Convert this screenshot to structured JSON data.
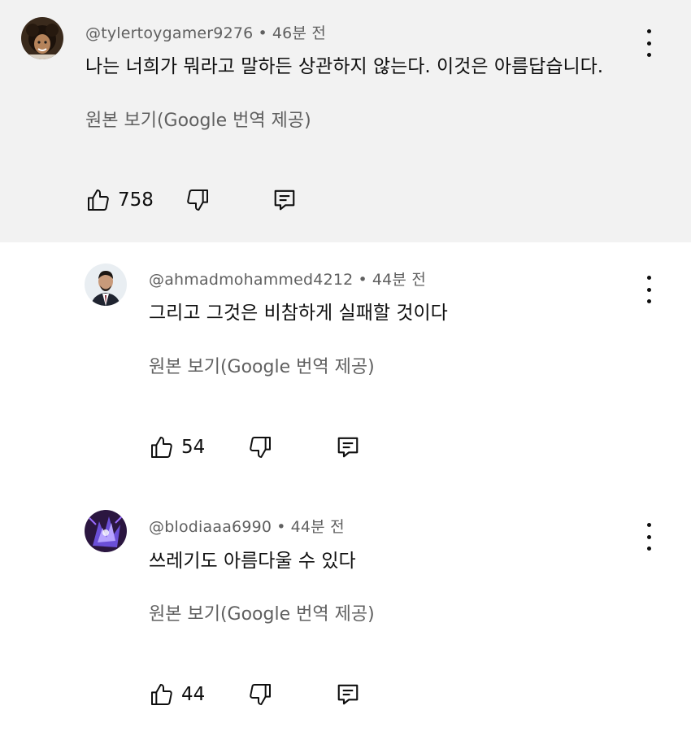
{
  "comments": [
    {
      "author": "@tylertoygamer9276",
      "time": "46분 전",
      "text": "나는 너희가 뭐라고 말하든 상관하지 않는다. 이것은 아름답습니다.",
      "translate_label": "원본 보기(Google 번역 제공)",
      "likes": "758"
    },
    {
      "author": "@ahmadmohammed4212",
      "time": "44분 전",
      "text": "그리고 그것은 비참하게 실패할 것이다",
      "translate_label": "원본 보기(Google 번역 제공)",
      "likes": "54"
    },
    {
      "author": "@blodiaaa6990",
      "time": "44분 전",
      "text": "쓰레기도 아름다울 수 있다",
      "translate_label": "원본 보기(Google 번역 제공)",
      "likes": "44"
    }
  ],
  "separator": "•",
  "icons": {
    "like": "thumb-up-icon",
    "dislike": "thumb-down-icon",
    "reply": "reply-icon",
    "more": "more-vertical-icon"
  },
  "colors": {
    "highlight_bg": "#f2f2f2",
    "secondary_text": "#606060",
    "primary_text": "#0f0f0f"
  }
}
